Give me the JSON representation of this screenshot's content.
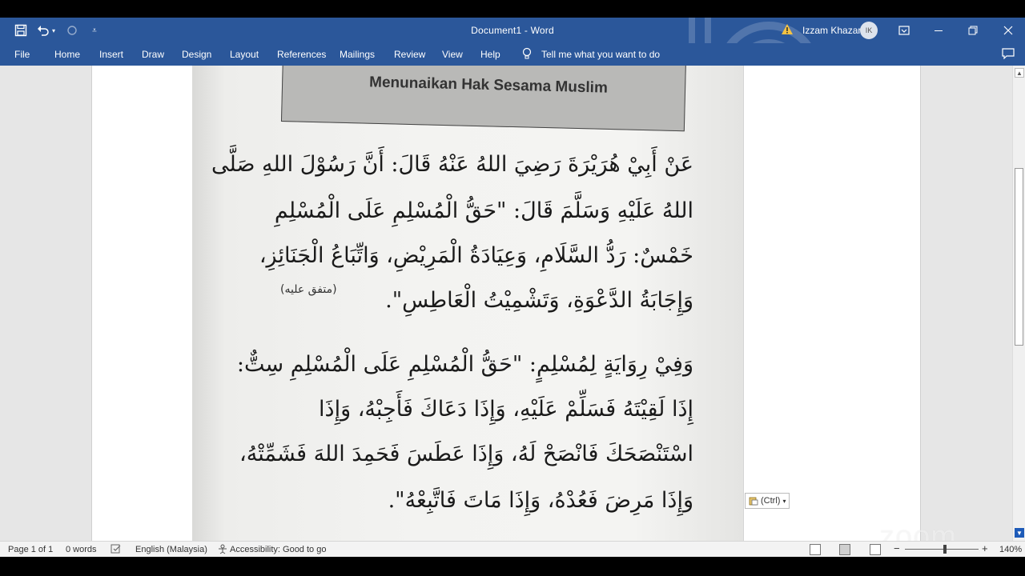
{
  "window": {
    "doc_title": "Document1  -  Word",
    "user_name": "Izzam Khazar",
    "user_initials": "IK"
  },
  "ribbon": {
    "tabs": [
      "File",
      "Home",
      "Insert",
      "Draw",
      "Design",
      "Layout",
      "References",
      "Mailings",
      "Review",
      "View",
      "Help"
    ],
    "tell_me": "Tell me what you want to do"
  },
  "document": {
    "heading": "Menunaikan Hak Sesama Muslim",
    "paragraph1": [
      "عَنْ أَبِيْ هُرَيْرَةَ رَضِيَ اللهُ عَنْهُ قَالَ: أَنَّ رَسُوْلَ اللهِ صَلَّى",
      "اللهُ عَلَيْهِ وَسَلَّمَ قَالَ: \"حَقُّ الْمُسْلِمِ عَلَى الْمُسْلِمِ",
      "خَمْسٌ: رَدُّ السَّلَامِ، وَعِيَادَةُ الْمَرِيْضِ، وَاتِّبَاعُ الْجَنَائِزِ،",
      "وَإِجَابَةُ الدَّعْوَةِ، وَتَشْمِيْتُ الْعَاطِسِ\"."
    ],
    "note": "(متفق عليه)",
    "paragraph2": [
      "وَفِيْ رِوَايَةٍ لِمُسْلِمٍ: \"حَقُّ الْمُسْلِمِ عَلَى الْمُسْلِمِ سِتٌّ:",
      "إِذَا لَقِيْتَهُ فَسَلِّمْ عَلَيْهِ، وَإِذَا دَعَاكَ فَأَجِبْهُ، وَإِذَا",
      "اسْتَنْصَحَكَ فَانْصَحْ لَهُ، وَإِذَا عَطَسَ فَحَمِدَ اللهَ فَشَمِّتْهُ،",
      "وَإِذَا مَرِضَ فَعُدْهُ، وَإِذَا مَاتَ فَاتَّبِعْهُ\"."
    ]
  },
  "paste_options": "(Ctrl)",
  "status": {
    "page": "Page 1 of 1",
    "words": "0 words",
    "language": "English (Malaysia)",
    "accessibility": "Accessibility: Good to go",
    "zoom": "140%"
  },
  "watermark": "zoom"
}
